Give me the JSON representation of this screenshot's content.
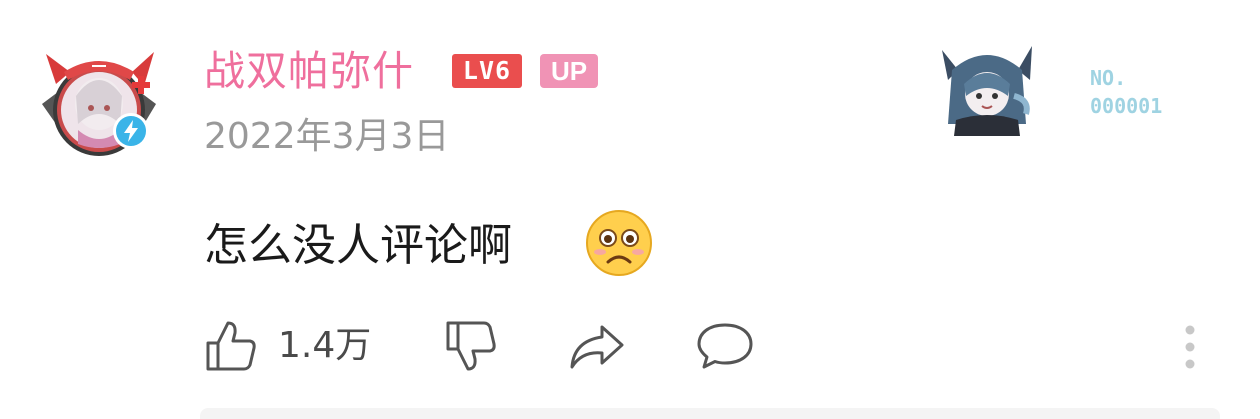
{
  "comment": {
    "username": "战双帕弥什",
    "level": "LV6",
    "up_badge": "UP",
    "date": "2022年3月3日",
    "text": "怎么没人评论啊",
    "emoji": "worried-face"
  },
  "fan_badge": {
    "no_label": "NO.",
    "number": "000001"
  },
  "actions": {
    "like_count": "1.4万"
  },
  "colors": {
    "username": "#ef6f9d",
    "level_badge": "#ea4e4e",
    "up_badge": "#f093b5",
    "fan_number": "#9fd3e2",
    "verified": "#3ab4e8"
  }
}
